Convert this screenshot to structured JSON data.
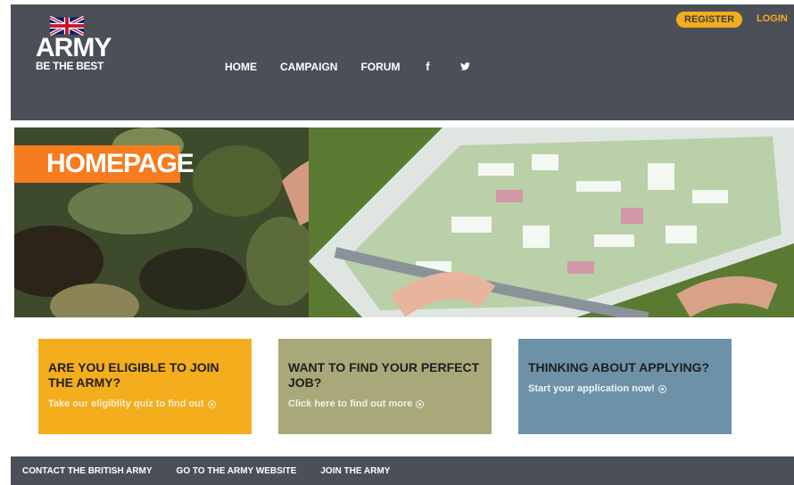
{
  "header": {
    "logo_text": "ARMY",
    "logo_tagline": "BE THE BEST",
    "nav": [
      {
        "label": "HOME"
      },
      {
        "label": "CAMPAIGN"
      },
      {
        "label": "FORUM"
      }
    ],
    "social": [
      {
        "icon": "facebook-icon",
        "glyph": "f"
      },
      {
        "icon": "twitter-icon",
        "glyph": "🐦"
      }
    ],
    "register_label": "REGISTER",
    "login_label": "LOGIN"
  },
  "hero": {
    "label": "HOMEPAGE"
  },
  "cards": [
    {
      "title": "ARE YOU ELIGIBLE TO JOIN THE ARMY?",
      "link": "Take our eligiblity quiz to find out",
      "color": "#f4ad1c"
    },
    {
      "title": "WANT TO FIND YOUR PERFECT JOB?",
      "link": "Click here to find out more",
      "color": "#a8a87b"
    },
    {
      "title": "THINKING ABOUT APPLYING?",
      "link": "Start your application now!",
      "color": "#6d92a8"
    }
  ],
  "footer": {
    "links": [
      {
        "label": "CONTACT THE BRITISH ARMY"
      },
      {
        "label": "GO TO THE ARMY WEBSITE"
      },
      {
        "label": "JOIN THE ARMY"
      }
    ]
  },
  "colors": {
    "header_bg": "#4b5058",
    "accent_orange": "#f57c1f",
    "accent_yellow": "#f4ad1c"
  }
}
